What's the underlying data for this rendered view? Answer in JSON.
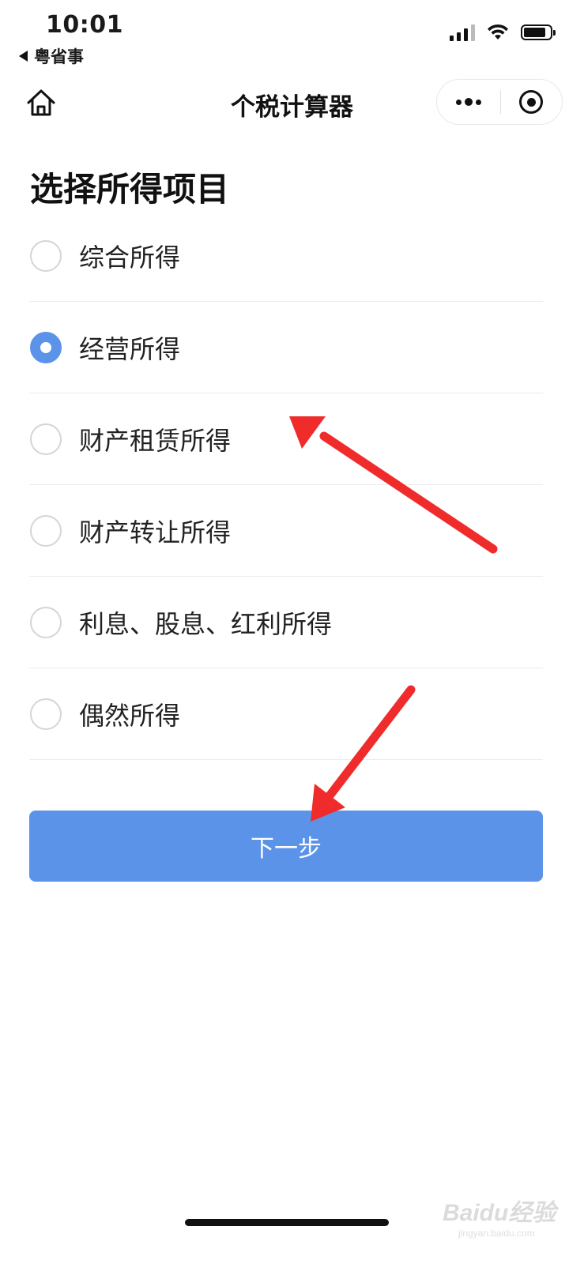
{
  "status_bar": {
    "time": "10:01",
    "back_app": "粤省事",
    "icons": [
      "signal-icon",
      "wifi-icon",
      "battery-icon"
    ]
  },
  "nav": {
    "title": "个税计算器",
    "home_icon": "home-icon",
    "more_icon": "more-dots-icon",
    "close_icon": "miniprogram-close-icon"
  },
  "page": {
    "section_title": "选择所得项目",
    "options": [
      {
        "label": "综合所得",
        "checked": false
      },
      {
        "label": "经营所得",
        "checked": true
      },
      {
        "label": "财产租赁所得",
        "checked": false
      },
      {
        "label": "财产转让所得",
        "checked": false
      },
      {
        "label": "利息、股息、红利所得",
        "checked": false
      },
      {
        "label": "偶然所得",
        "checked": false
      }
    ],
    "next_button": "下一步"
  },
  "annotations": {
    "arrow_color": "#f02b2b",
    "arrows": [
      "arrow-to-option",
      "arrow-to-next-button"
    ]
  },
  "colors": {
    "accent": "#5b93e9",
    "divider": "#ececec"
  },
  "watermark": {
    "main": "Baidu经验",
    "sub": "jingyan.baidu.com"
  }
}
